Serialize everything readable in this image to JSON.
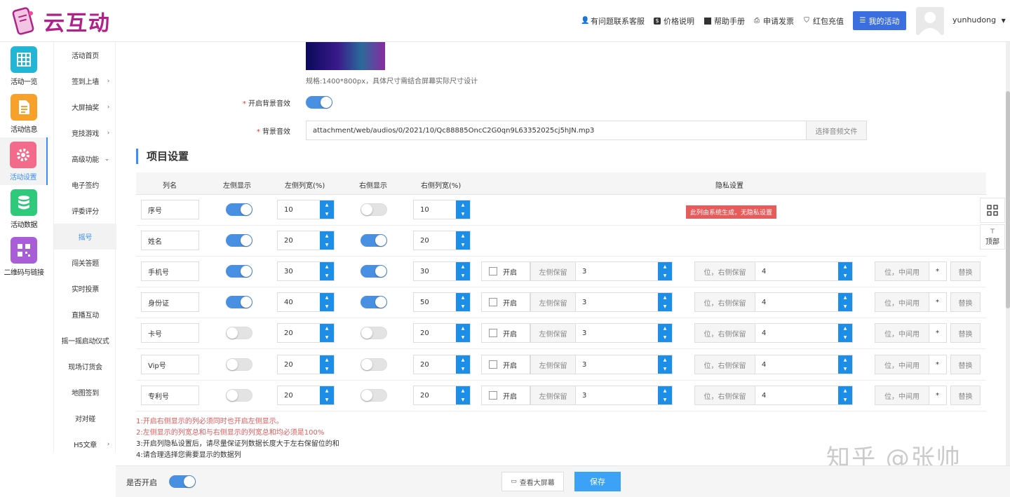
{
  "brand": {
    "logo_text": "云互动",
    "color": "#b0218a"
  },
  "topnav": {
    "support": "有问题联系客服",
    "pricing": "价格说明",
    "manual": "帮助手册",
    "invoice": "申请发票",
    "recharge": "红包充值",
    "my_activity": "我的活动",
    "username": "yunhudong"
  },
  "leftnav": [
    {
      "label": "活动一览",
      "icon": "grid-icon",
      "color": "#22b6d6"
    },
    {
      "label": "活动信息",
      "icon": "document-icon",
      "color": "#f7a12b"
    },
    {
      "label": "活动设置",
      "icon": "gear-icon",
      "color": "#f26b8a"
    },
    {
      "label": "活动数据",
      "icon": "database-icon",
      "color": "#2ec97a"
    },
    {
      "label": "二维码与链接",
      "icon": "qrcode-icon",
      "color": "#a95ed8"
    }
  ],
  "subnav": [
    {
      "label": "活动首页",
      "arrow": ""
    },
    {
      "label": "签到上墙",
      "arrow": "›"
    },
    {
      "label": "大屏抽奖",
      "arrow": "›"
    },
    {
      "label": "竞技游戏",
      "arrow": "›"
    },
    {
      "label": "高级功能",
      "arrow": "⌄"
    },
    {
      "label": "电子签约",
      "arrow": ""
    },
    {
      "label": "评委评分",
      "arrow": ""
    },
    {
      "label": "摇号",
      "arrow": ""
    },
    {
      "label": "闯关答题",
      "arrow": ""
    },
    {
      "label": "实时投票",
      "arrow": ""
    },
    {
      "label": "直播互动",
      "arrow": ""
    },
    {
      "label": "摇一摇启动仪式",
      "arrow": ""
    },
    {
      "label": "现场订货会",
      "arrow": ""
    },
    {
      "label": "地图签到",
      "arrow": ""
    },
    {
      "label": "对对碰",
      "arrow": ""
    },
    {
      "label": "H5文章",
      "arrow": "›"
    }
  ],
  "background": {
    "spec_hint": "规格:1400*800px，具体尺寸需结合屏幕实际尺寸设计",
    "music_enable_label": "开启背景音效",
    "music_enabled": true,
    "music_label": "背景音效",
    "music_path": "attachment/web/audios/0/2021/10/Qc88885OncC2G0qn9L63352025cj5hJN.mp3",
    "music_button": "选择音频文件"
  },
  "section_title": "项目设置",
  "table": {
    "headers": [
      "列名",
      "左侧显示",
      "左侧列宽(%)",
      "右侧显示",
      "右侧列宽(%)",
      "隐私设置"
    ],
    "privacy_badge": "此列由系统生成，无隐私设置",
    "rows": [
      {
        "name": "序号",
        "left_show": true,
        "left_width": "10",
        "right_show": false,
        "right_width": "10",
        "privacy": false
      },
      {
        "name": "姓名",
        "left_show": true,
        "left_width": "20",
        "right_show": true,
        "right_width": "20",
        "privacy": false
      },
      {
        "name": "手机号",
        "left_show": true,
        "left_width": "30",
        "right_show": true,
        "right_width": "30",
        "privacy": true,
        "keep_left": "3",
        "keep_right": "4"
      },
      {
        "name": "身份证",
        "left_show": true,
        "left_width": "40",
        "right_show": true,
        "right_width": "50",
        "privacy": true,
        "keep_left": "3",
        "keep_right": "4"
      },
      {
        "name": "卡号",
        "left_show": false,
        "left_width": "20",
        "right_show": false,
        "right_width": "20",
        "privacy": true,
        "keep_left": "3",
        "keep_right": "4"
      },
      {
        "name": "Vip号",
        "left_show": false,
        "left_width": "20",
        "right_show": false,
        "right_width": "20",
        "privacy": true,
        "keep_left": "3",
        "keep_right": "4"
      },
      {
        "name": "专利号",
        "left_show": false,
        "left_width": "20",
        "right_show": false,
        "right_width": "20",
        "privacy": true,
        "keep_left": "3",
        "keep_right": "4"
      }
    ],
    "privacy_labels": {
      "enable": "开启",
      "keep_left": "左侧保留",
      "keep_right": "位，右侧保留",
      "middle": "位，中间用",
      "mask": "*",
      "replace": "替换"
    }
  },
  "notes": [
    {
      "text": "1:开启右侧显示的列必须同时也开启左侧显示。",
      "color": "#e05a5a"
    },
    {
      "text": "2:左侧显示的列宽总和与右侧显示的列宽总和均必须是100%",
      "color": "#e05a5a"
    },
    {
      "text": "3:开启列隐私设置后，请尽量保证列数据长度大于左右保留位的和",
      "color": "#333333"
    },
    {
      "text": "4:请合理选择您需要显示的数据列",
      "color": "#333333"
    }
  ],
  "bottom": {
    "enable_label": "是否开启",
    "enabled": true,
    "view_screen": "查看大屏幕",
    "save": "保存"
  },
  "floating": {
    "top": "顶部"
  },
  "watermark": "知乎 @张帅"
}
